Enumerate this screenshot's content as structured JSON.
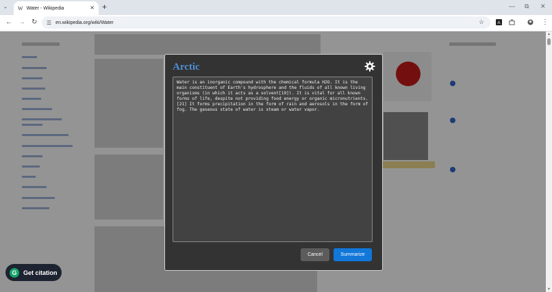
{
  "browser": {
    "tab_title": "Water - Wikipedia",
    "tab_favicon_letter": "W",
    "url": "en.wikipedia.org/wiki/Water"
  },
  "modal": {
    "title": "Arctic",
    "text": "Water is an inorganic compound with the chemical formula H2O. It is the main constituent of Earth's hydrosphere and the fluids of all known living organisms (in which it acts as a solvent[19]). It is vital for all known forms of life, despite not providing food energy or organic micronutrients. [21] It forms precipitation in the form of rain and aerosols in the form of fog. The gaseous state of water is steam or water vapor.",
    "cancel_label": "Cancel",
    "summarize_label": "Summarize"
  },
  "citation": {
    "icon_letter": "G",
    "label": "Get citation"
  },
  "colors": {
    "accent": "#1177d9",
    "title": "#4d8fd1",
    "modal_bg": "#333333"
  }
}
